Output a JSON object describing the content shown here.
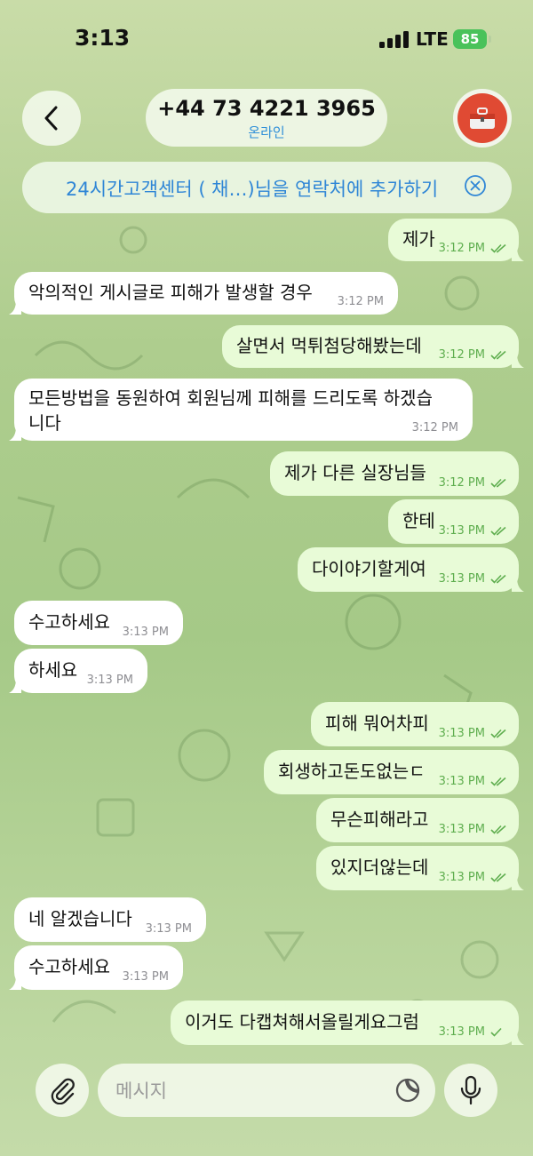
{
  "status_bar": {
    "time": "3:13",
    "network": "LTE",
    "battery": "85"
  },
  "header": {
    "title": "+44 73 4221 3965",
    "subtitle": "온라인",
    "back_icon": "chevron-left-icon",
    "avatar_icon": "toolbox-icon"
  },
  "add_contact_banner": {
    "text": "24시간고객센터 ( 채…)님을 연락처에 추가하기"
  },
  "messages": [
    {
      "dir": "out",
      "text": "제가",
      "time": "3:12 PM",
      "status": "read"
    },
    {
      "dir": "in",
      "text": "악의적인 게시글로 피해가 발생할 경우",
      "time": "3:12 PM"
    },
    {
      "dir": "out",
      "text": "살면서 먹튀첨당해봤는데",
      "time": "3:12 PM",
      "status": "read"
    },
    {
      "dir": "in",
      "lines": [
        "모든방법을 동원하여 회원님께 피해를 드리도록 하겠습",
        "니다"
      ],
      "time": "3:12 PM"
    },
    {
      "dir": "out",
      "text": "제가 다른 실장님들",
      "time": "3:12 PM",
      "status": "read"
    },
    {
      "dir": "out",
      "text": "한테",
      "time": "3:13 PM",
      "status": "read"
    },
    {
      "dir": "out",
      "text": "다이야기할게여",
      "time": "3:13 PM",
      "status": "read"
    },
    {
      "dir": "in",
      "text": "수고하세요",
      "time": "3:13 PM"
    },
    {
      "dir": "in",
      "text": "하세요",
      "time": "3:13 PM"
    },
    {
      "dir": "out",
      "text": "피해 뭐어차피",
      "time": "3:13 PM",
      "status": "read"
    },
    {
      "dir": "out",
      "text": "회생하고돈도없는ㄷ",
      "time": "3:13 PM",
      "status": "read"
    },
    {
      "dir": "out",
      "text": "무슨피해라고",
      "time": "3:13 PM",
      "status": "read"
    },
    {
      "dir": "out",
      "text": "있지더않는데",
      "time": "3:13 PM",
      "status": "read"
    },
    {
      "dir": "in",
      "text": "네 알겠습니다",
      "time": "3:13 PM"
    },
    {
      "dir": "in",
      "text": "수고하세요",
      "time": "3:13 PM"
    },
    {
      "dir": "out",
      "text": "이거도 다캡쳐해서올릴게요그럼",
      "time": "3:13 PM",
      "status": "sent"
    }
  ],
  "composer": {
    "placeholder": "메시지",
    "attach_icon": "paperclip-icon",
    "sticker_icon": "sticker-icon",
    "mic_icon": "microphone-icon"
  },
  "colors": {
    "incoming_bubble": "#ffffff",
    "outgoing_bubble": "#e8fbd7",
    "accent": "#2f86d6",
    "check": "#5fae4f",
    "battery": "#49c25a"
  }
}
